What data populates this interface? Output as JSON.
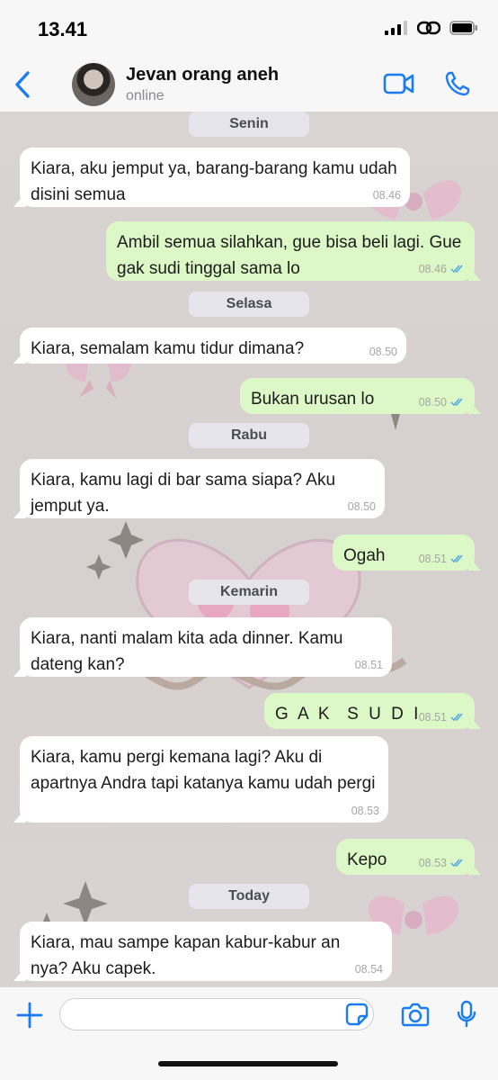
{
  "status": {
    "time": "13.41",
    "icons": [
      "signal-icon",
      "link-icon",
      "battery-icon"
    ]
  },
  "header": {
    "contact_name": "Jevan orang aneh",
    "presence": "online",
    "icons": [
      "back-chevron-icon",
      "video-call-icon",
      "phone-icon"
    ]
  },
  "colors": {
    "accent": "#1a7cf2",
    "outgoing_bubble": "#dcf8c6",
    "incoming_bubble": "#ffffff",
    "read_tick": "#4fa6e9"
  },
  "chat": {
    "day_1": "Senin",
    "msg_1": {
      "text": "Kiara, aku jemput ya, barang-barang kamu udah disini semua",
      "time": "08.46"
    },
    "msg_2": {
      "text": "Ambil semua silahkan, gue bisa beli lagi. Gue gak sudi tinggal sama lo",
      "time": "08.46",
      "status": "read"
    },
    "day_2": "Selasa",
    "msg_3": {
      "text": "Kiara, semalam kamu tidur dimana?",
      "time": "08.50"
    },
    "msg_4": {
      "text": "Bukan urusan lo",
      "time": "08.50",
      "status": "read"
    },
    "day_3": "Rabu",
    "msg_5": {
      "text": "Kiara, kamu lagi di bar sama siapa? Aku jemput ya.",
      "time": "08.50"
    },
    "msg_6": {
      "text": "Ogah",
      "time": "08.51",
      "status": "read"
    },
    "day_4": "Kemarin",
    "msg_7": {
      "text": "Kiara, nanti malam kita ada dinner. Kamu dateng kan?",
      "time": "08.51"
    },
    "msg_8": {
      "text": "G A K  S U D I",
      "time": "08.51",
      "status": "read"
    },
    "msg_9": {
      "text": "Kiara, kamu pergi kemana lagi? Aku di apartnya Andra tapi katanya kamu udah pergi",
      "time": "08.53"
    },
    "msg_10": {
      "text": "Kepo",
      "time": "08.53",
      "status": "read"
    },
    "day_5": "Today",
    "msg_11": {
      "text": "Kiara, mau sampe kapan kabur-kabur an nya? Aku capek.",
      "time": "08.54"
    }
  },
  "composer": {
    "placeholder": "",
    "icons": [
      "plus-icon",
      "sticker-icon",
      "camera-icon",
      "microphone-icon"
    ]
  }
}
